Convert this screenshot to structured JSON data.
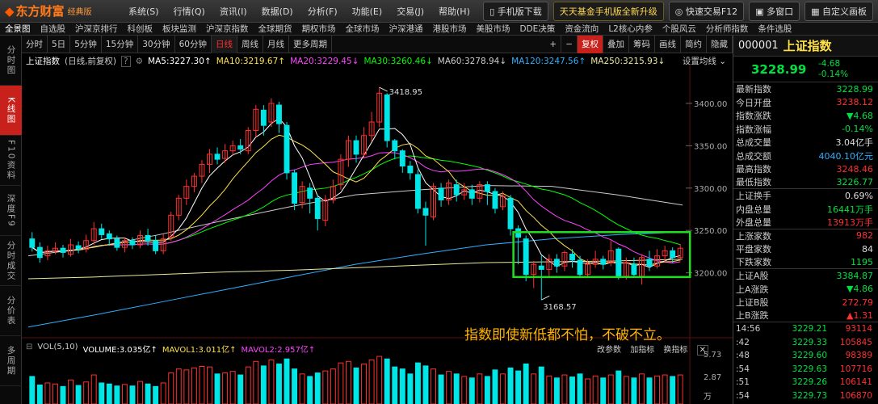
{
  "app": {
    "logo": "东方财富",
    "edition": "经典版"
  },
  "menu": [
    "系统(S)",
    "行情(Q)",
    "资讯(I)",
    "数据(D)",
    "分析(F)",
    "功能(E)",
    "交易(J)",
    "帮助(H)"
  ],
  "top_buttons": {
    "mobile": "手机版下载",
    "promo": "天天基金手机版全新升级",
    "quick_trade": "快速交易F12",
    "multi_window": "多窗口",
    "custom": "自定义画板"
  },
  "nav_items": [
    "全景图",
    "自选股",
    "沪深京排行",
    "科创板",
    "板块监测",
    "沪深京指数",
    "全球期货",
    "期权市场",
    "全球市场",
    "沪深港通",
    "港股市场",
    "美股市场",
    "DDE决策",
    "资金流向",
    "L2核心内参",
    "个股风云",
    "分析师指数",
    "条件选股"
  ],
  "left_nav": [
    {
      "label": "分时图"
    },
    {
      "label": "K线图",
      "active": true
    },
    {
      "label": "F10资料"
    },
    {
      "label": "深度F9"
    },
    {
      "label": "分时成交"
    },
    {
      "label": "分价表"
    },
    {
      "label": "多周期"
    }
  ],
  "periods": [
    "分时",
    "5日",
    "5分钟",
    "15分钟",
    "30分钟",
    "60分钟",
    "日线",
    "周线",
    "月线",
    "更多周期"
  ],
  "selected_period": "日线",
  "tools": [
    "+",
    "−",
    "复权",
    "叠加",
    "筹码",
    "画线",
    "简约",
    "隐藏"
  ],
  "infobar": {
    "name": "上证指数",
    "desc": "(日线,前复权)",
    "ma": [
      {
        "label": "MA5:3227.30↑",
        "color": "#ffffff"
      },
      {
        "label": "MA10:3219.67↑",
        "color": "#ffe14a"
      },
      {
        "label": "MA20:3229.45↓",
        "color": "#ff44ff"
      },
      {
        "label": "MA30:3260.46↓",
        "color": "#00ff00"
      },
      {
        "label": "MA60:3278.94↓",
        "color": "#cccccc"
      },
      {
        "label": "MA120:3247.56↑",
        "color": "#30b0ff"
      },
      {
        "label": "MA250:3215.93↓",
        "color": "#e8e8a0"
      }
    ],
    "settings": "设置均线"
  },
  "vol": {
    "title": "VOL(5,10)",
    "volume": "VOLUME:3.035亿↑",
    "mavol1": "MAVOL1:3.011亿↑",
    "mavol2": "MAVOL2:2.957亿↑",
    "tools": [
      "改参数",
      "加指标",
      "换指标"
    ]
  },
  "annotations": {
    "high": "3418.95",
    "low": "3168.57",
    "slogan": "指数即使新低都不怕，不破不立。"
  },
  "colors": {
    "up": "#ff3030",
    "down": "#00e5e5",
    "ma5": "#ffffff",
    "ma10": "#ffe14a",
    "ma20": "#ff44ff",
    "ma30": "#00ff00",
    "ma60": "#cccccc",
    "ma120": "#30b0ff",
    "ma250": "#e8e8a0",
    "box": "#22dd22"
  },
  "chart_data": {
    "type": "candlestick",
    "title": "上证指数",
    "y_ticks": [
      3400,
      3350,
      3300,
      3250,
      3200
    ],
    "ylim": [
      3130,
      3440
    ],
    "vol_ticks": [
      "5.73",
      "2.87",
      "万"
    ],
    "candles": [
      [
        3240,
        3230,
        3248,
        3225
      ],
      [
        3230,
        3218,
        3236,
        3212
      ],
      [
        3220,
        3226,
        3232,
        3215
      ],
      [
        3226,
        3229,
        3236,
        3222
      ],
      [
        3229,
        3224,
        3233,
        3218
      ],
      [
        3222,
        3233,
        3240,
        3219
      ],
      [
        3232,
        3228,
        3237,
        3223
      ],
      [
        3228,
        3238,
        3245,
        3224
      ],
      [
        3238,
        3252,
        3260,
        3233
      ],
      [
        3252,
        3245,
        3258,
        3240
      ],
      [
        3246,
        3240,
        3250,
        3232
      ],
      [
        3240,
        3230,
        3244,
        3226
      ],
      [
        3230,
        3238,
        3242,
        3224
      ],
      [
        3238,
        3233,
        3242,
        3228
      ],
      [
        3233,
        3244,
        3250,
        3229
      ],
      [
        3244,
        3238,
        3252,
        3232
      ],
      [
        3238,
        3226,
        3244,
        3222
      ],
      [
        3226,
        3240,
        3246,
        3222
      ],
      [
        3242,
        3268,
        3272,
        3238
      ],
      [
        3268,
        3288,
        3292,
        3262
      ],
      [
        3288,
        3302,
        3310,
        3280
      ],
      [
        3302,
        3314,
        3318,
        3295
      ],
      [
        3314,
        3328,
        3333,
        3306
      ],
      [
        3328,
        3340,
        3346,
        3318
      ],
      [
        3340,
        3334,
        3348,
        3328
      ],
      [
        3335,
        3344,
        3352,
        3330
      ],
      [
        3344,
        3350,
        3356,
        3338
      ],
      [
        3350,
        3346,
        3358,
        3340
      ],
      [
        3344,
        3368,
        3372,
        3340
      ],
      [
        3368,
        3393,
        3398,
        3360
      ],
      [
        3392,
        3374,
        3398,
        3362
      ],
      [
        3378,
        3400,
        3406,
        3372
      ],
      [
        3398,
        3376,
        3402,
        3365
      ],
      [
        3374,
        3318,
        3378,
        3310
      ],
      [
        3318,
        3282,
        3322,
        3274
      ],
      [
        3283,
        3302,
        3308,
        3276
      ],
      [
        3300,
        3288,
        3306,
        3270
      ],
      [
        3288,
        3264,
        3292,
        3250
      ],
      [
        3262,
        3286,
        3292,
        3255
      ],
      [
        3286,
        3302,
        3310,
        3282
      ],
      [
        3304,
        3334,
        3340,
        3298
      ],
      [
        3334,
        3356,
        3362,
        3325
      ],
      [
        3356,
        3340,
        3362,
        3330
      ],
      [
        3340,
        3362,
        3372,
        3336
      ],
      [
        3362,
        3378,
        3390,
        3355
      ],
      [
        3378,
        3412,
        3419,
        3372
      ],
      [
        3410,
        3356,
        3412,
        3348
      ],
      [
        3356,
        3344,
        3358,
        3334
      ],
      [
        3344,
        3326,
        3346,
        3318
      ],
      [
        3326,
        3318,
        3332,
        3310
      ],
      [
        3316,
        3276,
        3322,
        3270
      ],
      [
        3276,
        3268,
        3284,
        3232
      ],
      [
        3266,
        3302,
        3306,
        3262
      ],
      [
        3300,
        3286,
        3306,
        3278
      ],
      [
        3286,
        3306,
        3310,
        3280
      ],
      [
        3304,
        3292,
        3310,
        3284
      ],
      [
        3292,
        3298,
        3306,
        3286
      ],
      [
        3298,
        3288,
        3304,
        3280
      ],
      [
        3288,
        3304,
        3308,
        3283
      ],
      [
        3304,
        3296,
        3308,
        3280
      ],
      [
        3296,
        3276,
        3300,
        3270
      ],
      [
        3278,
        3290,
        3296,
        3274
      ],
      [
        3288,
        3252,
        3292,
        3244
      ],
      [
        3252,
        3242,
        3256,
        3210
      ],
      [
        3240,
        3198,
        3244,
        3190
      ],
      [
        3198,
        3210,
        3214,
        3182
      ],
      [
        3208,
        3204,
        3220,
        3168
      ],
      [
        3204,
        3216,
        3222,
        3196
      ],
      [
        3216,
        3208,
        3222,
        3200
      ],
      [
        3208,
        3224,
        3226,
        3202
      ],
      [
        3222,
        3215,
        3228,
        3206
      ],
      [
        3215,
        3198,
        3220,
        3194
      ],
      [
        3198,
        3210,
        3216,
        3194
      ],
      [
        3210,
        3216,
        3226,
        3206
      ],
      [
        3216,
        3210,
        3220,
        3204
      ],
      [
        3212,
        3226,
        3238,
        3208
      ],
      [
        3228,
        3196,
        3230,
        3192
      ],
      [
        3196,
        3212,
        3218,
        3192
      ],
      [
        3210,
        3198,
        3218,
        3194
      ],
      [
        3196,
        3218,
        3222,
        3186
      ],
      [
        3216,
        3208,
        3226,
        3202
      ],
      [
        3208,
        3220,
        3228,
        3205
      ],
      [
        3220,
        3226,
        3232,
        3213
      ],
      [
        3226,
        3218,
        3230,
        3212
      ],
      [
        3218,
        3229,
        3234,
        3214
      ]
    ],
    "vol_vals": [
      55,
      38,
      42,
      40,
      35,
      48,
      37,
      44,
      58,
      42,
      40,
      36,
      39,
      36,
      45,
      40,
      35,
      42,
      62,
      70,
      68,
      72,
      75,
      74,
      60,
      62,
      65,
      58,
      74,
      85,
      76,
      88,
      80,
      90,
      70,
      60,
      55,
      62,
      66,
      70,
      82,
      85,
      72,
      80,
      88,
      95,
      90,
      74,
      70,
      60,
      82,
      76,
      70,
      58,
      65,
      60,
      55,
      52,
      60,
      55,
      68,
      60,
      72,
      66,
      80,
      60,
      74,
      56,
      52,
      58,
      54,
      60,
      50,
      56,
      52,
      58,
      66,
      55,
      52,
      60,
      52,
      56,
      58,
      55,
      58
    ]
  },
  "quote": {
    "code": "000001",
    "name": "上证指数",
    "price": "3228.99",
    "change": "-4.68",
    "pct": "-0.14%",
    "rows": [
      {
        "label": "最新指数",
        "value": "3228.99",
        "color": "#00e040"
      },
      {
        "label": "今日开盘",
        "value": "3238.12",
        "color": "#ff3030"
      },
      {
        "label": "指数涨跌",
        "value": "▼4.68",
        "color": "#00e040"
      },
      {
        "label": "指数涨幅",
        "value": "-0.14%",
        "color": "#00e040"
      },
      {
        "label": "总成交量",
        "value": "3.04亿手",
        "color": "#dddddd"
      },
      {
        "label": "总成交额",
        "value": "4040.10亿元",
        "color": "#30b0ff"
      },
      {
        "label": "最高指数",
        "value": "3248.46",
        "color": "#ff3030"
      },
      {
        "label": "最低指数",
        "value": "3226.77",
        "color": "#00e040"
      },
      {
        "label": "上证换手",
        "value": "0.69%",
        "color": "#dddddd"
      },
      {
        "label": "内盘总量",
        "value": "16441万手",
        "color": "#00e040"
      },
      {
        "label": "外盘总量",
        "value": "13913万手",
        "color": "#ff3030"
      },
      {
        "label": "上涨家数",
        "value": "982",
        "color": "#ff3030"
      },
      {
        "label": "平盘家数",
        "value": "84",
        "color": "#dddddd"
      },
      {
        "label": "下跌家数",
        "value": "1195",
        "color": "#00e040"
      },
      {
        "label": "上证A股",
        "value": "3384.87",
        "color": "#00e040"
      },
      {
        "label": "上A涨跌",
        "value": "▼4.86",
        "color": "#00e040"
      },
      {
        "label": "上证B股",
        "value": "272.79",
        "color": "#ff3030"
      },
      {
        "label": "上B涨跌",
        "value": "▲1.31",
        "color": "#ff3030"
      }
    ],
    "ticks": [
      {
        "t": "14:56",
        "p": "3229.21",
        "v": "93114"
      },
      {
        "t": ":42",
        "p": "3229.33",
        "v": "105845"
      },
      {
        "t": ":48",
        "p": "3229.60",
        "v": "98389"
      },
      {
        "t": ":54",
        "p": "3229.63",
        "v": "107716"
      },
      {
        "t": ":51",
        "p": "3229.26",
        "v": "106141"
      },
      {
        "t": ":54",
        "p": "3229.73",
        "v": "106870"
      }
    ]
  }
}
